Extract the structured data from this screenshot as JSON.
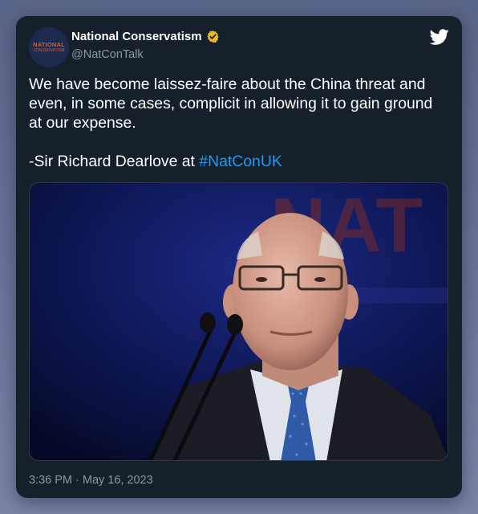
{
  "author": {
    "display_name": "National Conservatism",
    "handle": "@NatConTalk",
    "avatar_text_line1": "NATIONAL",
    "avatar_text_line2": "CONSERVATISM",
    "verified_badge_color": "#e8b923",
    "avatar_icon": "natcon-logo-icon"
  },
  "tweet": {
    "text_main": "We have become laissez-faire about the China threat and even, in some cases, complicit in allowing it to gain ground at our expense.",
    "text_attribution_prefix": "-Sir Richard Dearlove at ",
    "hashtag": "#NatConUK",
    "timestamp": "3:36 PM · May 16, 2023",
    "hashtag_color": "#1d9bf0",
    "platform_icon": "twitter-bird-icon"
  },
  "media": {
    "backdrop_text": "NAT"
  }
}
